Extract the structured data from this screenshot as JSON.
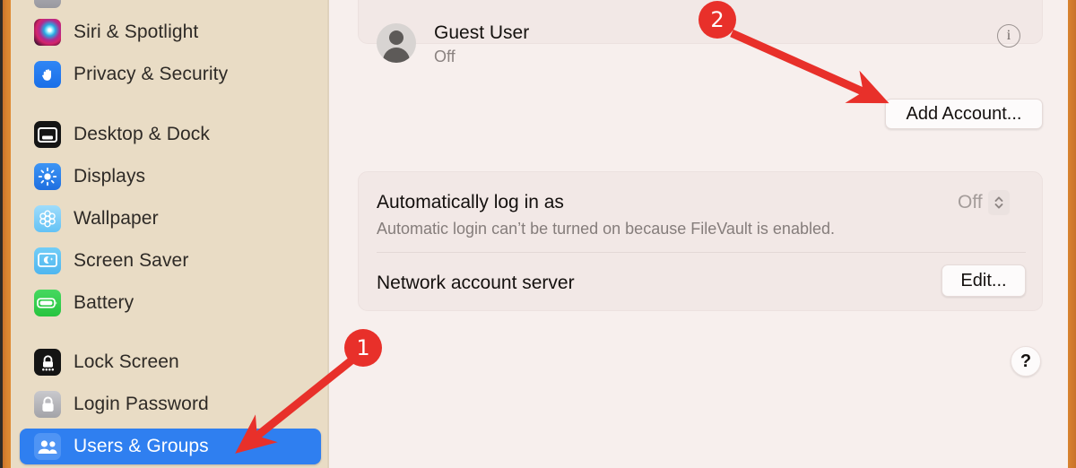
{
  "window": {
    "accent_orange": "#d9832f",
    "sidebar_bg": "#e9dcc5",
    "content_bg": "#f7efed",
    "selection_blue": "#2f7ff0",
    "annotation_red": "#e8302a"
  },
  "sidebar": {
    "items": [
      {
        "label": "",
        "icon": "partial-cut-icon",
        "selected": false,
        "partial": true
      },
      {
        "label": "Siri & Spotlight",
        "icon": "siri-icon",
        "selected": false
      },
      {
        "label": "Privacy & Security",
        "icon": "hand-icon",
        "selected": false
      },
      {
        "label": "Desktop & Dock",
        "icon": "desktop-dock-icon",
        "selected": false
      },
      {
        "label": "Displays",
        "icon": "brightness-icon",
        "selected": false
      },
      {
        "label": "Wallpaper",
        "icon": "flower-icon",
        "selected": false
      },
      {
        "label": "Screen Saver",
        "icon": "moon-screen-icon",
        "selected": false
      },
      {
        "label": "Battery",
        "icon": "battery-icon",
        "selected": false
      },
      {
        "label": "Lock Screen",
        "icon": "lock-dots-icon",
        "selected": false
      },
      {
        "label": "Login Password",
        "icon": "padlock-icon",
        "selected": false
      },
      {
        "label": "Users & Groups",
        "icon": "two-people-icon",
        "selected": true
      }
    ]
  },
  "main": {
    "accounts_card": {
      "guest": {
        "name": "Guest User",
        "status": "Off",
        "avatar": "person-avatar",
        "info_icon": "info-icon"
      },
      "add_account_label": "Add Account..."
    },
    "options_card": {
      "auto_login_title": "Automatically log in as",
      "auto_login_description": "Automatic login can’t be turned on because FileVault is enabled.",
      "auto_login_value": "Off",
      "auto_login_stepper": "up-down-chevron-icon",
      "network_account_server_label": "Network account server",
      "edit_label": "Edit..."
    },
    "help_label": "?"
  },
  "annotations": [
    {
      "number": "1",
      "target": "sidebar-item-users-groups"
    },
    {
      "number": "2",
      "target": "add-account-button"
    }
  ]
}
